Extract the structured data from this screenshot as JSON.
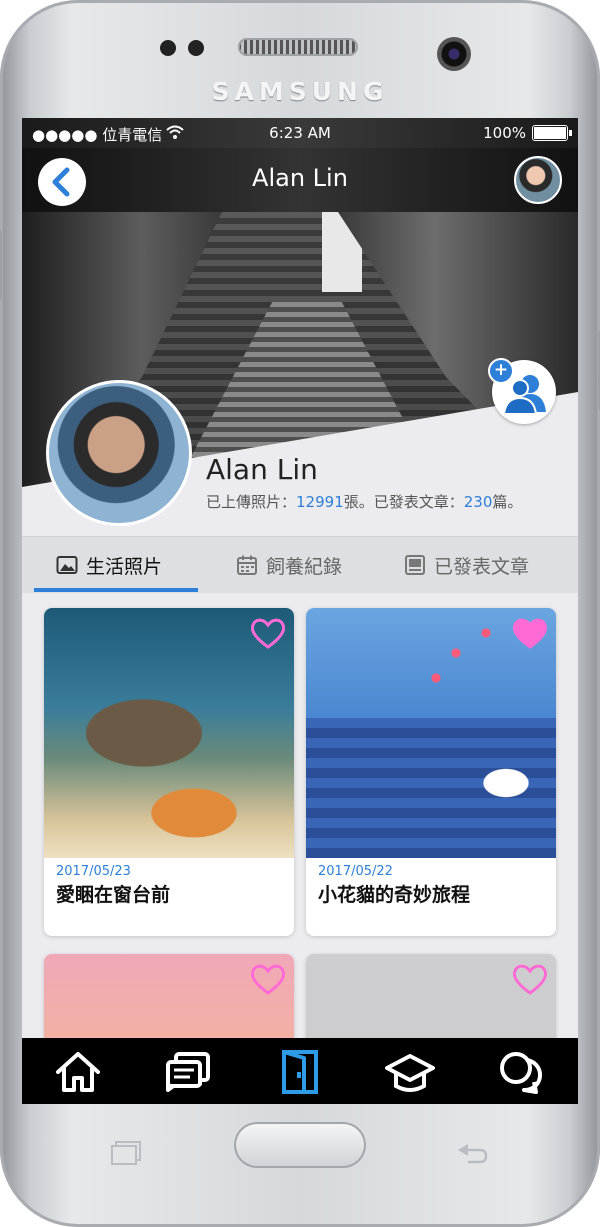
{
  "device": {
    "brand": "SAMSUNG"
  },
  "status_bar": {
    "carrier": "●●●●● 位青電信",
    "time": "6:23 AM",
    "battery": "100%"
  },
  "nav": {
    "title": "Alan Lin"
  },
  "profile": {
    "name": "Alan Lin",
    "stats_prefix": "已上傳照片：",
    "photo_count": "12991",
    "stats_mid": "張。已發表文章：",
    "post_count": "230",
    "stats_suffix": "篇。"
  },
  "tabs": [
    {
      "label": "生活照片",
      "icon": "photo-icon",
      "active": true
    },
    {
      "label": "飼養紀錄",
      "icon": "calendar-icon",
      "active": false
    },
    {
      "label": "已發表文章",
      "icon": "article-icon",
      "active": false
    }
  ],
  "cards": [
    {
      "date": "2017/05/23",
      "title": "愛睏在窗台前",
      "liked": false
    },
    {
      "date": "2017/05/22",
      "title": "小花貓的奇妙旅程",
      "liked": true
    },
    {
      "date": "",
      "title": "",
      "liked": false
    },
    {
      "date": "",
      "title": "",
      "liked": false
    }
  ],
  "bottom_nav": [
    "home-icon",
    "messages-icon",
    "door-icon",
    "graduation-cap-icon",
    "chat-icon"
  ],
  "colors": {
    "accent": "#2d7fd8",
    "heart": "#ff6ad5",
    "nav_bg": "#000000"
  }
}
